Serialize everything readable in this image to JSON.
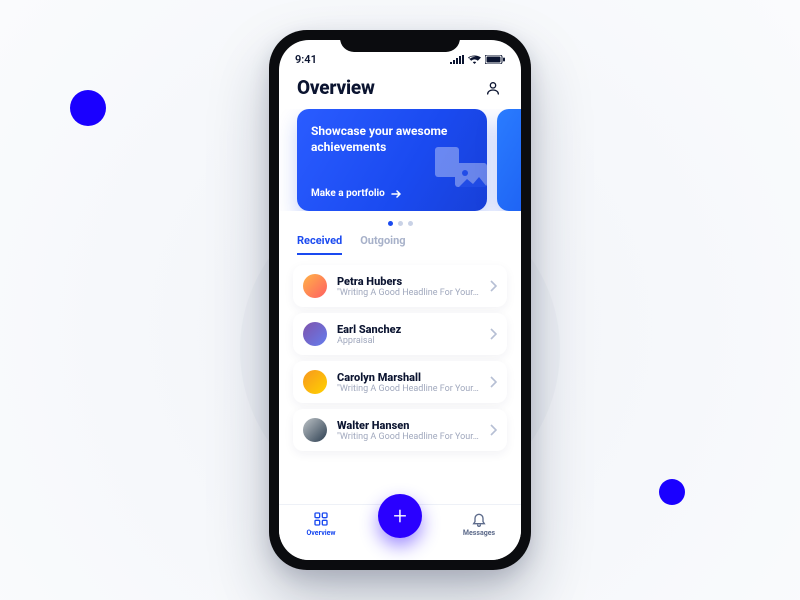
{
  "status": {
    "time": "9:41"
  },
  "header": {
    "title": "Overview"
  },
  "promo": {
    "title": "Showcase your awesome achievements",
    "cta": "Make a portfolio"
  },
  "tabs": {
    "received": "Received",
    "outgoing": "Outgoing"
  },
  "items": [
    {
      "name": "Petra Hubers",
      "sub": "\"Writing A Good Headline For Your...\""
    },
    {
      "name": "Earl Sanchez",
      "sub": "Appraisal"
    },
    {
      "name": "Carolyn Marshall",
      "sub": "\"Writing A Good Headline For Your...\""
    },
    {
      "name": "Walter Hansen",
      "sub": "\"Writing A Good Headline For Your...\""
    }
  ],
  "nav": {
    "overview": "Overview",
    "messages": "Messages"
  }
}
